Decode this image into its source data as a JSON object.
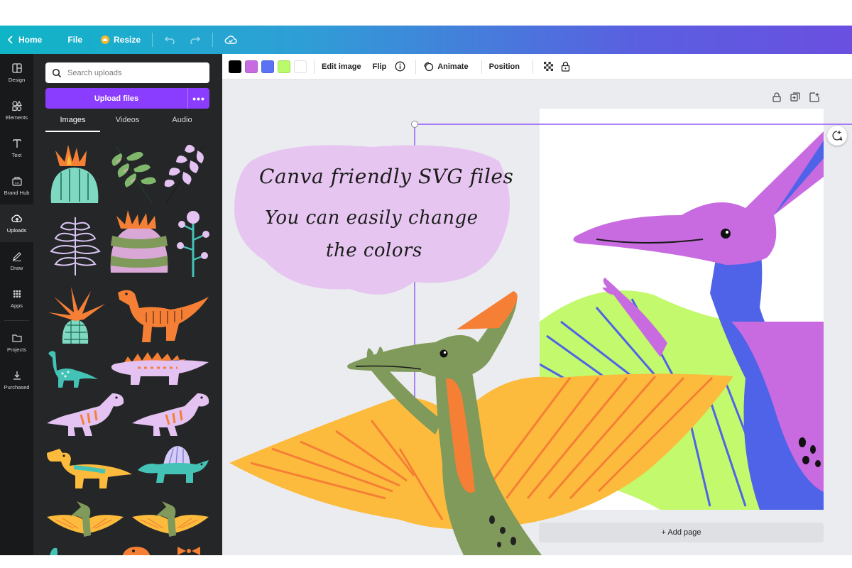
{
  "topbar": {
    "home_label": "Home",
    "file_label": "File",
    "resize_label": "Resize"
  },
  "rail": {
    "items": [
      {
        "label": "Design",
        "icon": "layout-icon"
      },
      {
        "label": "Elements",
        "icon": "shapes-icon"
      },
      {
        "label": "Text",
        "icon": "text-icon"
      },
      {
        "label": "Brand Hub",
        "icon": "brand-hub-icon"
      },
      {
        "label": "Uploads",
        "icon": "upload-cloud-icon",
        "active": true
      },
      {
        "label": "Draw",
        "icon": "pen-icon"
      },
      {
        "label": "Apps",
        "icon": "apps-grid-icon"
      },
      {
        "label": "Projects",
        "icon": "folder-icon"
      },
      {
        "label": "Purchased",
        "icon": "download-icon"
      }
    ]
  },
  "uploads": {
    "search_placeholder": "Search uploads",
    "upload_button": "Upload files",
    "more_label": "•••",
    "tabs": [
      "Images",
      "Videos",
      "Audio"
    ],
    "active_tab": "Images"
  },
  "toolbar": {
    "swatches": [
      "#000000",
      "#c86be0",
      "#5b72f5",
      "#b9fb6b",
      "#ffffff"
    ],
    "edit_image": "Edit image",
    "flip": "Flip",
    "animate": "Animate",
    "position": "Position"
  },
  "canvas": {
    "text_line1": "Canva friendly SVG files",
    "text_line2": "You can easily change",
    "text_line3": "the colors",
    "add_page": "+ Add page"
  },
  "colors": {
    "accent": "#8b3dff",
    "bubble": "#e6c6f0",
    "wing_yellow": "#fcbb3c",
    "body_green": "#7f9a5a",
    "crest_orange": "#f57f35",
    "dino_purple": "#c86be0",
    "dino_blue": "#4f63e8",
    "lime": "#c3f96c"
  }
}
